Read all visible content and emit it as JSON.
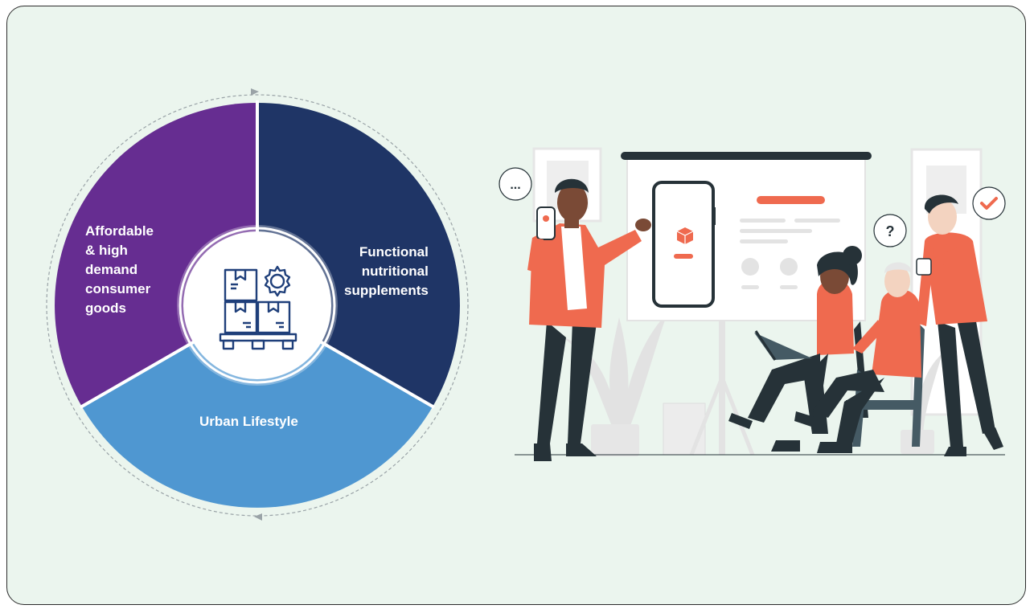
{
  "segments": {
    "left": {
      "label": "Affordable\n& high\ndemand\nconsumer\ngoods",
      "color": "#662d91"
    },
    "right": {
      "label": "Functional\nnutritional\nsupplements",
      "color": "#1f3566"
    },
    "bottom": {
      "label": "Urban Lifestyle",
      "color": "#4f97d1"
    }
  },
  "center_icon": "boxes-pallet-gear-icon",
  "illustration": {
    "speech_bubbles": [
      "...",
      "?"
    ],
    "check_icon": "check-icon",
    "colors": {
      "accent": "#ef6a4f",
      "dark": "#263238",
      "light": "#e6e6e6"
    }
  }
}
